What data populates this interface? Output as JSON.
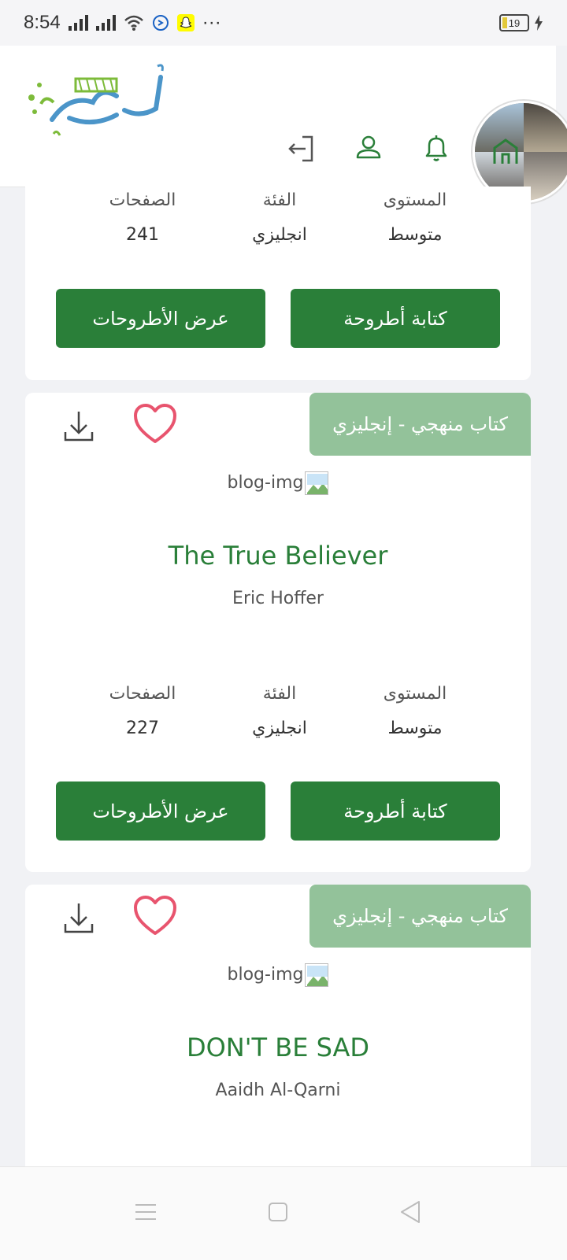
{
  "status_bar": {
    "time": "8:54",
    "more": "···",
    "battery": "19"
  },
  "header": {
    "logo_text": "أطروحة",
    "nav_icons": [
      "home-icon",
      "bell-icon",
      "user-icon",
      "logout-icon"
    ]
  },
  "top_card": {
    "meta": {
      "level_label": "المستوى",
      "level_value": "متوسط",
      "category_label": "الفئة",
      "category_value": "انجليزي",
      "pages_label": "الصفحات",
      "pages_value": "241"
    },
    "write_button": "كتابة أطروحة",
    "view_button": "عرض الأطروحات"
  },
  "books": [
    {
      "tag": "كتاب منهجي - إنجليزي",
      "image_alt": "blog-img",
      "title": "The True Believer",
      "author": "Eric Hoffer",
      "meta": {
        "level_label": "المستوى",
        "level_value": "متوسط",
        "category_label": "الفئة",
        "category_value": "انجليزي",
        "pages_label": "الصفحات",
        "pages_value": "227"
      },
      "write_button": "كتابة أطروحة",
      "view_button": "عرض الأطروحات"
    },
    {
      "tag": "كتاب منهجي - إنجليزي",
      "image_alt": "blog-img",
      "title": "DON'T BE SAD",
      "author": "Aaidh Al-Qarni"
    }
  ],
  "colors": {
    "primary_green": "#2a7f39",
    "tag_green": "#93c29a",
    "heart_pink": "#e8546e"
  }
}
